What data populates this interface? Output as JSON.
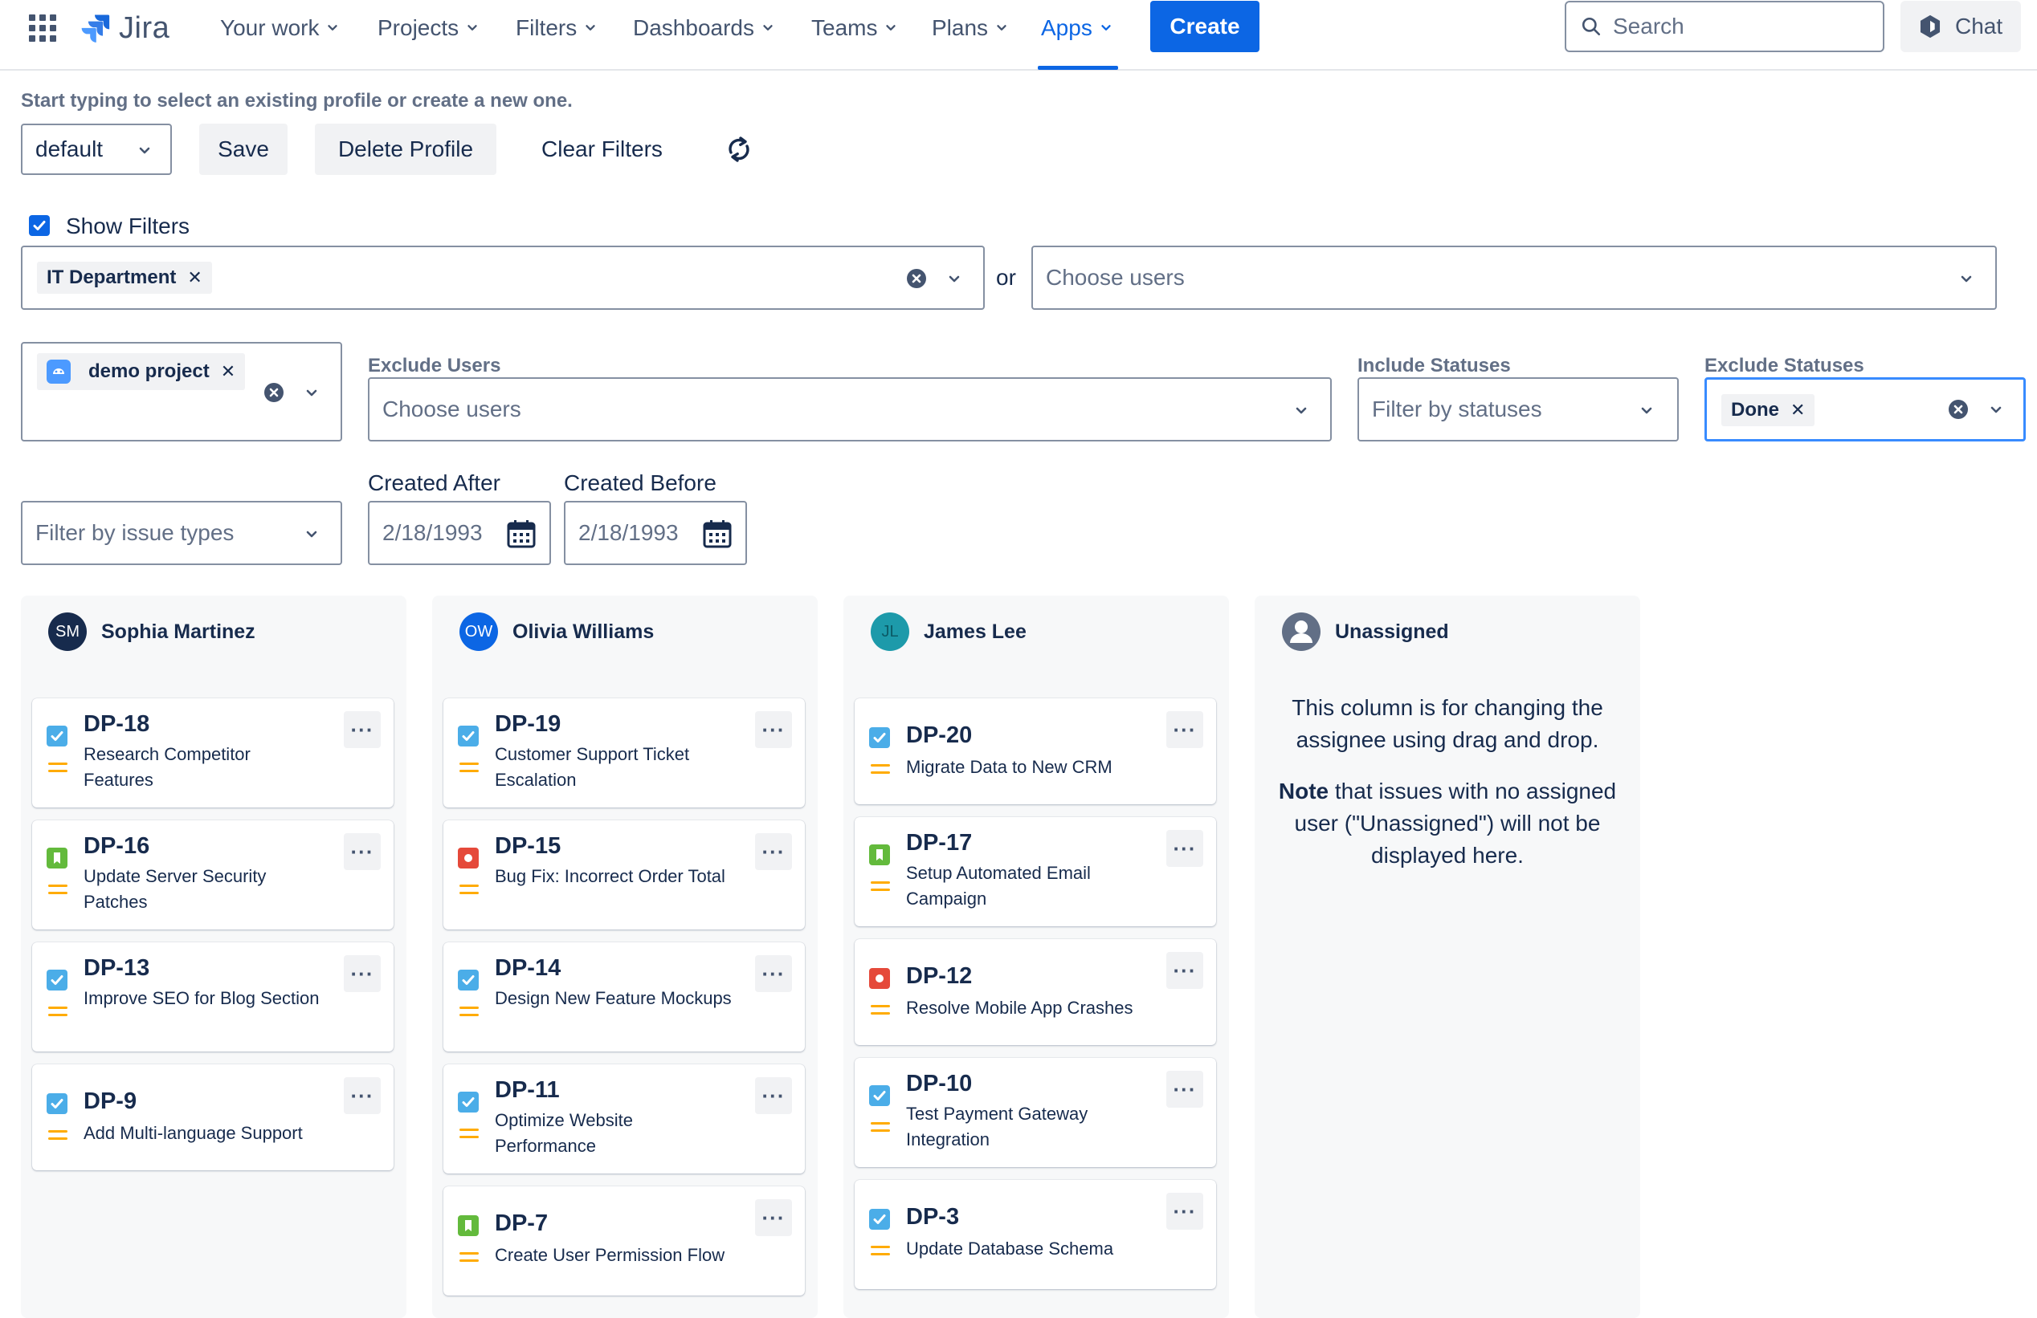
{
  "nav": {
    "brand": "Jira",
    "items": [
      {
        "label": "Your work"
      },
      {
        "label": "Projects"
      },
      {
        "label": "Filters"
      },
      {
        "label": "Dashboards"
      },
      {
        "label": "Teams"
      },
      {
        "label": "Plans"
      },
      {
        "label": "Apps",
        "active": true
      }
    ],
    "create_label": "Create",
    "search_placeholder": "Search",
    "chat_label": "Chat"
  },
  "profile": {
    "hint": "Start typing to select an existing profile or create a new one.",
    "selected": "default",
    "save_label": "Save",
    "delete_label": "Delete Profile",
    "clear_label": "Clear Filters"
  },
  "filters": {
    "show_filters_label": "Show Filters",
    "show_filters_checked": true,
    "groups_tag": "IT Department",
    "or_label": "or",
    "users_placeholder": "Choose users",
    "project_tag": "demo project",
    "exclude_users": {
      "label": "Exclude Users",
      "placeholder": "Choose users"
    },
    "include_statuses": {
      "label": "Include Statuses",
      "placeholder": "Filter by statuses"
    },
    "exclude_statuses": {
      "label": "Exclude Statuses",
      "tag": "Done"
    },
    "issue_types_placeholder": "Filter by issue types",
    "created_after": {
      "label": "Created After",
      "value": "2/18/1993"
    },
    "created_before": {
      "label": "Created Before",
      "value": "2/18/1993"
    }
  },
  "colors": {
    "primary": "#0c66e4",
    "task": "#4bade8",
    "story": "#63ba3c",
    "bug": "#e5493a",
    "priority_medium": "#ffab00"
  },
  "board": {
    "columns": [
      {
        "name": "Sophia Martinez",
        "initials": "SM",
        "avatar_color": "#172b4d",
        "cards": [
          {
            "key": "DP-18",
            "summary": "Research Competitor Features",
            "type": "task"
          },
          {
            "key": "DP-16",
            "summary": "Update Server Security Patches",
            "type": "story"
          },
          {
            "key": "DP-13",
            "summary": "Improve SEO for Blog Section",
            "type": "task"
          },
          {
            "key": "DP-9",
            "summary": "Add Multi-language Support",
            "type": "task"
          }
        ]
      },
      {
        "name": "Olivia Williams",
        "initials": "OW",
        "avatar_color": "#0c66e4",
        "cards": [
          {
            "key": "DP-19",
            "summary": "Customer Support Ticket Escalation",
            "type": "task"
          },
          {
            "key": "DP-15",
            "summary": "Bug Fix: Incorrect Order Total",
            "type": "bug"
          },
          {
            "key": "DP-14",
            "summary": "Design New Feature Mockups",
            "type": "task"
          },
          {
            "key": "DP-11",
            "summary": "Optimize Website Performance",
            "type": "task"
          },
          {
            "key": "DP-7",
            "summary": "Create User Permission Flow",
            "type": "story"
          }
        ]
      },
      {
        "name": "James Lee",
        "initials": "JL",
        "avatar_color": "#1d9aaa",
        "cards": [
          {
            "key": "DP-20",
            "summary": "Migrate Data to New CRM",
            "type": "task"
          },
          {
            "key": "DP-17",
            "summary": "Setup Automated Email Campaign",
            "type": "story"
          },
          {
            "key": "DP-12",
            "summary": "Resolve Mobile App Crashes",
            "type": "bug"
          },
          {
            "key": "DP-10",
            "summary": "Test Payment Gateway Integration",
            "type": "task"
          },
          {
            "key": "DP-3",
            "summary": "Update Database Schema",
            "type": "task"
          }
        ]
      },
      {
        "name": "Unassigned",
        "note_line1": "This column is for changing the assignee using drag and drop.",
        "note_bold": "Note",
        "note_line2": " that issues with no assigned user (\"Unassigned\") will not be displayed here."
      }
    ]
  }
}
